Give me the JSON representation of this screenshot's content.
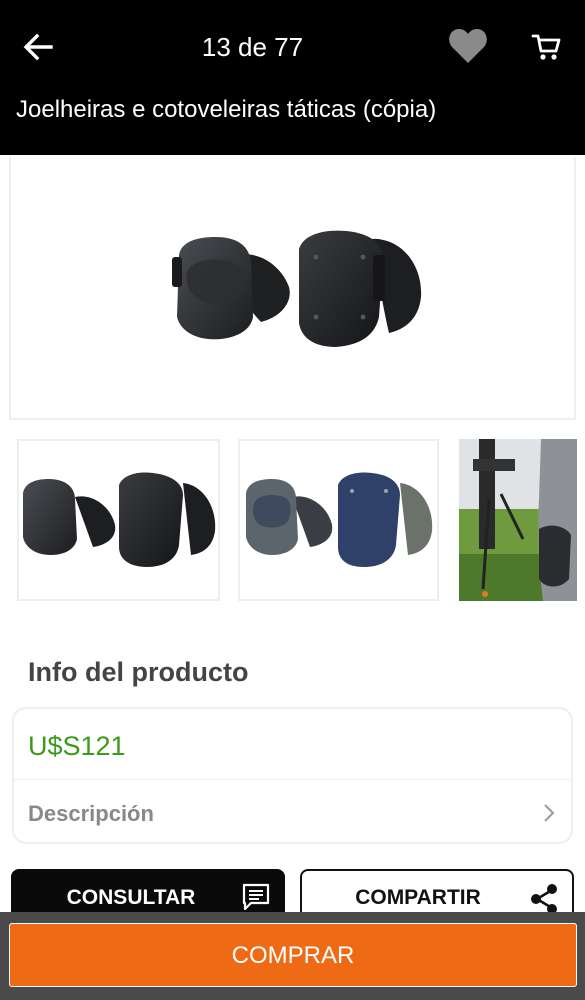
{
  "header": {
    "back_icon": "arrow-left-icon",
    "counter": "13 de 77",
    "favorite_icon": "heart-icon",
    "cart_icon": "cart-icon",
    "title": "Joelheiras e cotoveleiras táticas (cópia)"
  },
  "gallery": {
    "main_image": "black elbow pad and knee pad",
    "thumbnails": [
      "black elbow pad and knee pad",
      "grey and navy elbow pad and knee pad",
      "person kneeling on grass with rifle and bipod"
    ]
  },
  "product_info": {
    "section_title": "Info del producto",
    "price": "U$S121",
    "description_label": "Descripción",
    "chevron_icon": "chevron-right-icon"
  },
  "actions": {
    "consult_label": "CONSULTAR",
    "consult_icon": "chat-icon",
    "share_label": "COMPARTIR",
    "share_icon": "share-icon",
    "buy_label": "COMPRAR"
  },
  "colors": {
    "header_bg": "#000000",
    "price": "#3c9a1a",
    "buy_button": "#ef6a14"
  }
}
